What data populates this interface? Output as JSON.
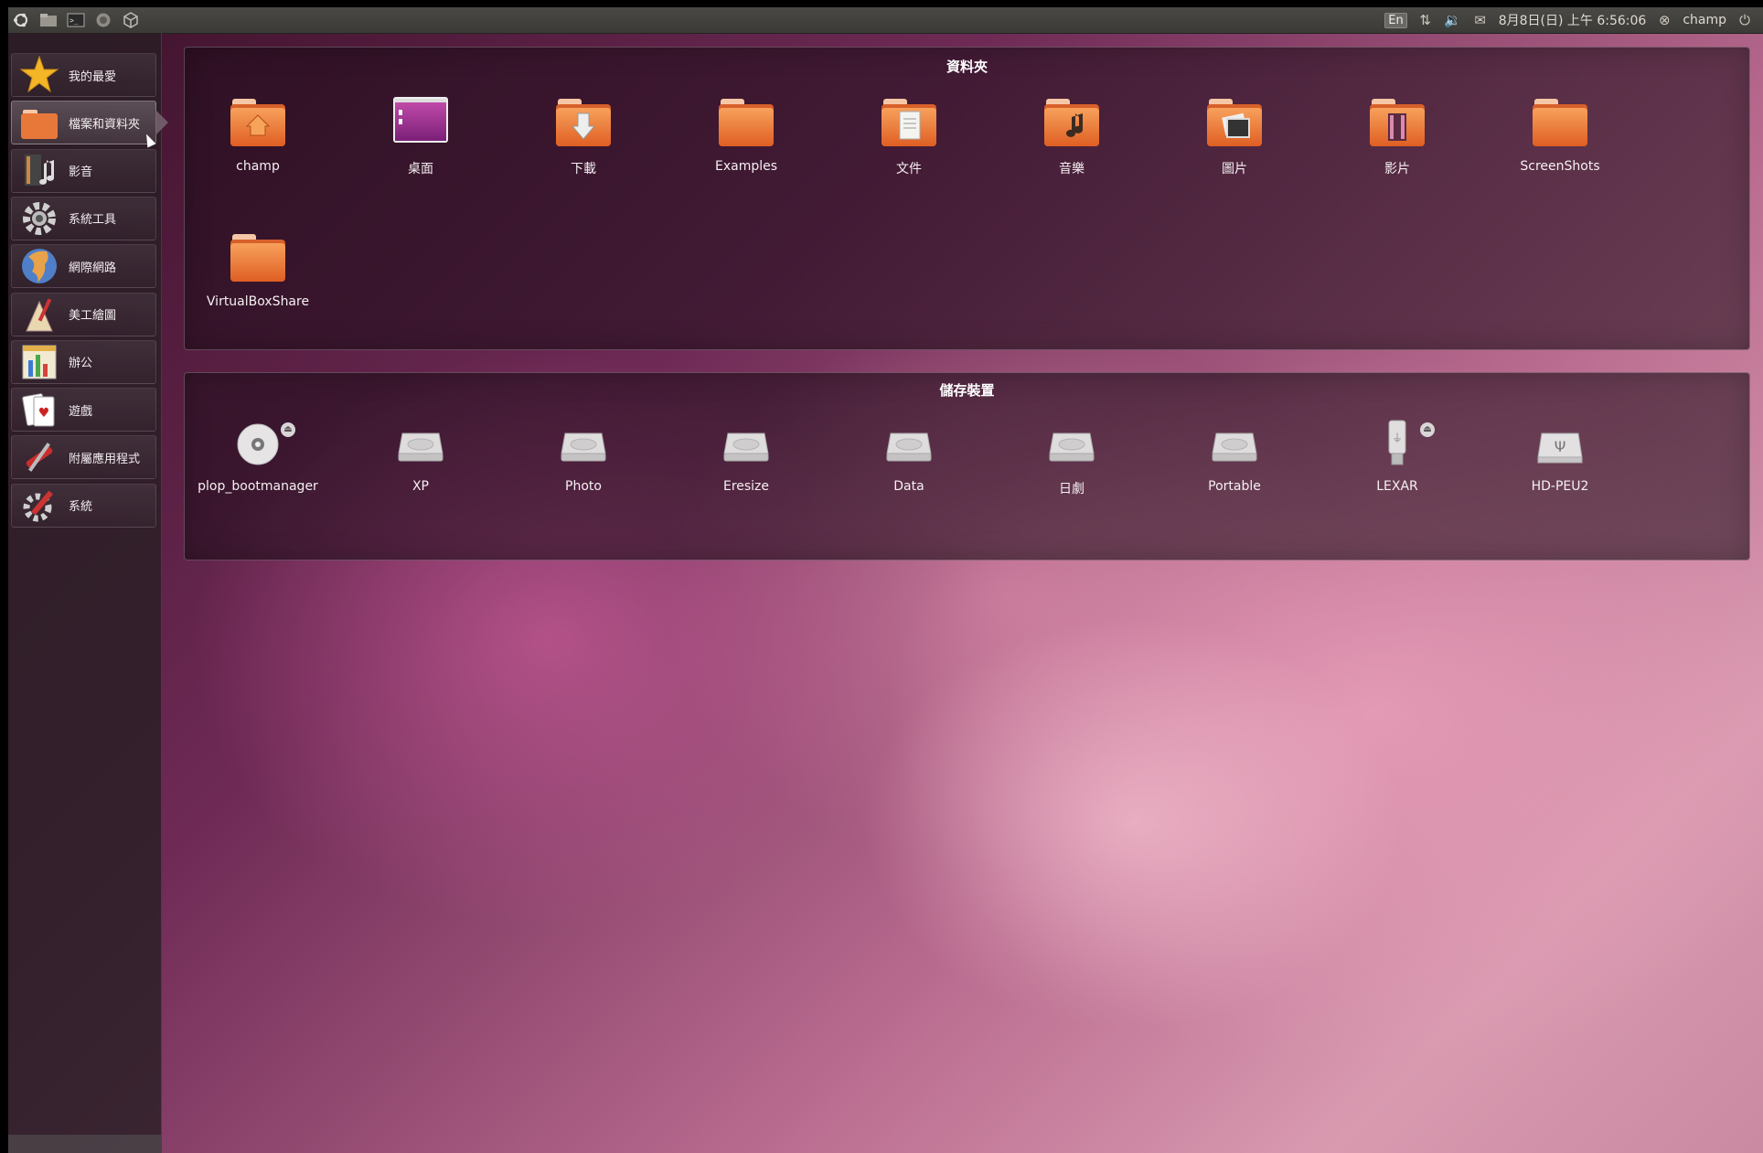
{
  "top_panel": {
    "icons": [
      "ubuntu-logo-icon",
      "files-icon",
      "terminal-icon",
      "firefox-icon",
      "package-icon"
    ],
    "lang": "En",
    "datetime": "8月8日(日) 上午 6:56:06",
    "user": "champ"
  },
  "sidebar": {
    "items": [
      {
        "label": "我的最愛",
        "icon": "star-icon"
      },
      {
        "label": "檔案和資料夾",
        "icon": "folder-icon",
        "active": true
      },
      {
        "label": "影音",
        "icon": "multimedia-icon"
      },
      {
        "label": "系統工具",
        "icon": "gear-icon"
      },
      {
        "label": "網際網路",
        "icon": "globe-icon"
      },
      {
        "label": "美工繪圖",
        "icon": "graphics-icon"
      },
      {
        "label": "辦公",
        "icon": "office-icon"
      },
      {
        "label": "遊戲",
        "icon": "cards-icon"
      },
      {
        "label": "附屬應用程式",
        "icon": "accessories-icon"
      },
      {
        "label": "系統",
        "icon": "system-icon"
      }
    ]
  },
  "folders": {
    "title": "資料夾",
    "items": [
      {
        "label": "champ",
        "icon": "home-folder-icon"
      },
      {
        "label": "桌面",
        "icon": "desktop-folder-icon"
      },
      {
        "label": "下載",
        "icon": "downloads-folder-icon"
      },
      {
        "label": "Examples",
        "icon": "folder-icon"
      },
      {
        "label": "文件",
        "icon": "documents-folder-icon"
      },
      {
        "label": "音樂",
        "icon": "music-folder-icon"
      },
      {
        "label": "圖片",
        "icon": "pictures-folder-icon"
      },
      {
        "label": "影片",
        "icon": "videos-folder-icon"
      },
      {
        "label": "ScreenShots",
        "icon": "folder-icon"
      },
      {
        "label": "VirtualBoxShare",
        "icon": "folder-icon"
      }
    ]
  },
  "storage": {
    "title": "儲存裝置",
    "items": [
      {
        "label": "plop_bootmanager",
        "icon": "cd-icon",
        "ejectable": true
      },
      {
        "label": "XP",
        "icon": "hard-drive-icon"
      },
      {
        "label": "Photo",
        "icon": "hard-drive-icon"
      },
      {
        "label": "Eresize",
        "icon": "hard-drive-icon"
      },
      {
        "label": "Data",
        "icon": "hard-drive-icon"
      },
      {
        "label": "日劇",
        "icon": "hard-drive-icon"
      },
      {
        "label": "Portable",
        "icon": "hard-drive-icon"
      },
      {
        "label": "LEXAR",
        "icon": "usb-drive-icon",
        "ejectable": true
      },
      {
        "label": "HD-PEU2",
        "icon": "usb-hard-drive-icon"
      }
    ]
  },
  "colors": {
    "folder_orange": "#e8783a",
    "panel_dark": "#3b3a36",
    "accent_pink": "#c96a96"
  }
}
